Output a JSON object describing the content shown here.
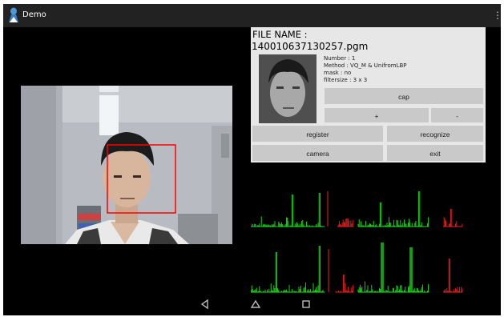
{
  "app": {
    "title": "Demo"
  },
  "icons": {
    "app": "app-figure-icon",
    "overflow": "overflow-menu-icon",
    "back": "back-icon",
    "home": "home-icon",
    "recents": "recents-icon"
  },
  "panel": {
    "file_label": "FILE NAME :",
    "file_name": "140010637130257.pgm",
    "info": {
      "number": "Number : 1",
      "method": "Method : VQ_M & UnifromLBP",
      "mask": "mask : no",
      "filtersize": "filtersize : 3 x 3"
    },
    "buttons": {
      "cap": "cap",
      "plus": "+",
      "minus": "-",
      "register": "register",
      "recognize": "recognize",
      "camera": "camera",
      "exit": "exit"
    }
  },
  "colors": {
    "face_box": "#ff0000",
    "hist_green": "#19e619",
    "hist_red": "#f02020",
    "panel_bg": "#e7e7e7",
    "button_bg": "#c9c9c9"
  }
}
